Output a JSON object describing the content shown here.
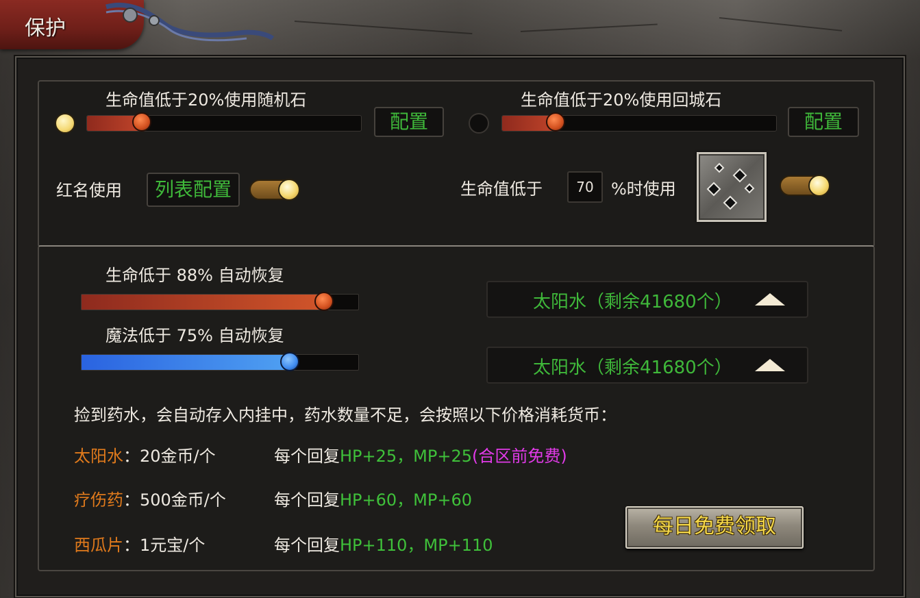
{
  "window": {
    "title": "保护"
  },
  "top": {
    "left_rule": {
      "label": "生命值低于20%使用随机石",
      "enabled": true,
      "slider_percent": 20,
      "config_label": "配置"
    },
    "right_rule": {
      "label": "生命值低于20%使用回城石",
      "enabled": false,
      "slider_percent": 20,
      "config_label": "配置"
    },
    "red_name": {
      "label": "红名使用",
      "list_config_label": "列表配置",
      "toggle_on": true
    },
    "hp_skill": {
      "label_before": "生命值低于",
      "value": "70",
      "label_after": "%时使用",
      "toggle_on": true
    }
  },
  "recovery": {
    "hp": {
      "label": "生命低于  88%  自动恢复",
      "percent": 88,
      "item": "太阳水（剩余41680个）"
    },
    "mp": {
      "label": "魔法低于  75%  自动恢复",
      "percent": 75,
      "item": "太阳水（剩余41680个）"
    }
  },
  "notice": "捡到药水，会自动存入内挂中，药水数量不足，会按照以下价格消耗货币：",
  "potions": [
    {
      "name": "太阳水",
      "price": "：20金币/个",
      "effect_prefix": "每个回复",
      "effect": "HP+25，MP+25",
      "extra": "(合区前免费)"
    },
    {
      "name": "疗伤药",
      "price": "：500金币/个",
      "effect_prefix": "每个回复",
      "effect": "HP+60，MP+60",
      "extra": ""
    },
    {
      "name": "西瓜片",
      "price": "：1元宝/个",
      "effect_prefix": "每个回复",
      "effect": "HP+110，MP+110",
      "extra": ""
    }
  ],
  "daily_button": "每日免费领取",
  "colors": {
    "accent_green": "#3fc03a",
    "potion_orange": "#e07a1c",
    "free_pink": "#e13ae8",
    "hp_bar": "#c0442a",
    "mp_bar": "#3f8bef"
  }
}
